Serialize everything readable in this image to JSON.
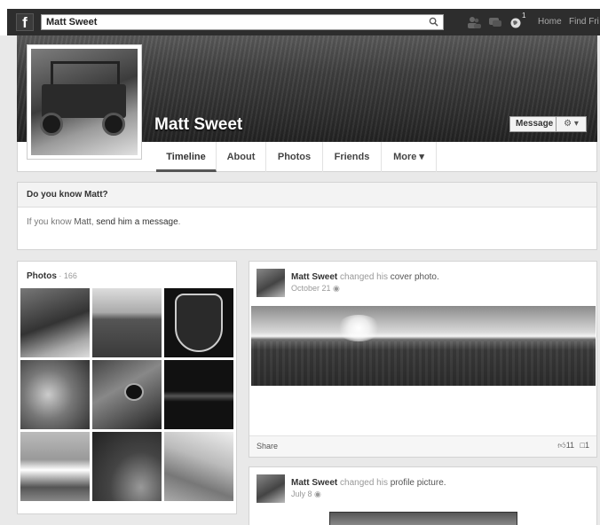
{
  "topbar": {
    "logo": "f",
    "search_value": "Matt Sweet",
    "nav_home": "Home",
    "nav_find": "Find Fri",
    "notification_count": "1"
  },
  "profile": {
    "name": "Matt Sweet",
    "message_button": "Message",
    "gear_button": "⚙ ▾"
  },
  "tabs": [
    "Timeline",
    "About",
    "Photos",
    "Friends",
    "More ▾"
  ],
  "know_box": {
    "title": "Do you know Matt?",
    "text_prefix": "If you know ",
    "name_link": "Matt",
    "text_mid": ", ",
    "action_link": "send him a message",
    "text_suffix": "."
  },
  "photos": {
    "title": "Photos",
    "separator": " · ",
    "count": "166"
  },
  "posts": [
    {
      "author": "Matt Sweet",
      "verb": " changed his ",
      "object": "cover photo.",
      "date": "October 21",
      "share": "Share",
      "likes": "11",
      "comments": "1"
    },
    {
      "author": "Matt Sweet",
      "verb": " changed his ",
      "object": "profile picture.",
      "date": "July 8"
    }
  ],
  "colors": {
    "bar": "#2d2d2d",
    "page_bg": "#e9e9e9",
    "panel_bg": "#ffffff"
  }
}
